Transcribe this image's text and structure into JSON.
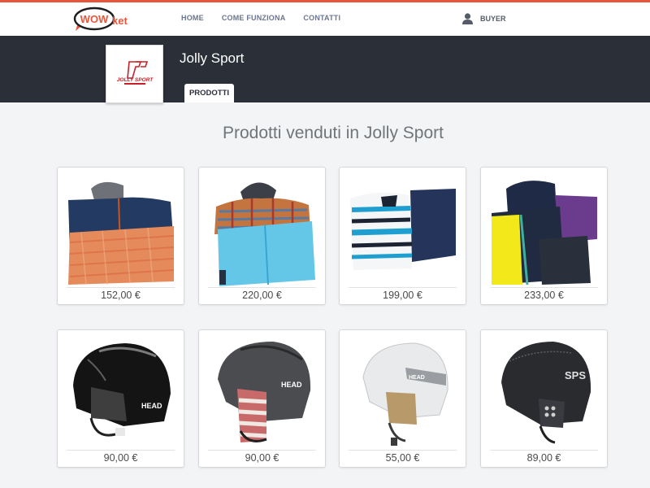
{
  "navbar": {
    "logo_text_left": "WOW",
    "logo_text_right": "ket",
    "links": [
      "HOME",
      "COME FUNZIONA",
      "CONTATTI"
    ],
    "user_label": "BUYER"
  },
  "shop": {
    "name": "Jolly Sport",
    "logo_text": "JOLLY SPORT",
    "tab_label": "PRODOTTI"
  },
  "main": {
    "section_title": "Prodotti venduti in Jolly Sport",
    "products": [
      {
        "price": "152,00 €",
        "image": "ski-jacket-orange-pants"
      },
      {
        "price": "220,00 €",
        "image": "plaid-jacket-blue-pants"
      },
      {
        "price": "199,00 €",
        "image": "striped-jacket-navy-pants"
      },
      {
        "price": "233,00 €",
        "image": "navy-yellow-jacket-purple"
      },
      {
        "price": "90,00 €",
        "image": "black-head-helmet"
      },
      {
        "price": "90,00 €",
        "image": "gray-head-helmet-striped-liner"
      },
      {
        "price": "55,00 €",
        "image": "white-head-helmet"
      },
      {
        "price": "89,00 €",
        "image": "black-sps-helmet"
      }
    ]
  },
  "colors": {
    "accent": "#e8573b",
    "header_dark": "#2b2f38",
    "nav_link": "#6b7591"
  }
}
